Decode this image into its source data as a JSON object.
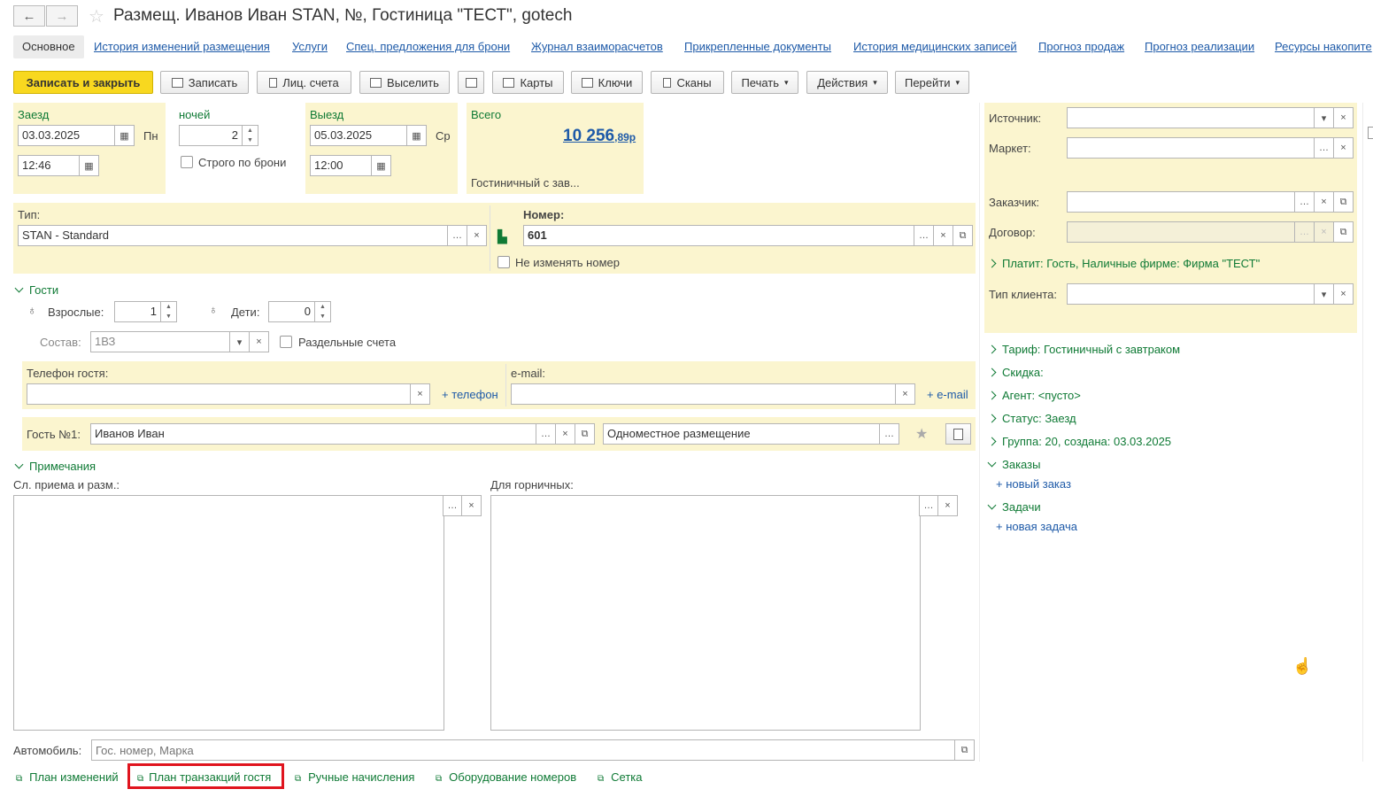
{
  "window": {
    "title": "Размещ. Иванов Иван STAN, №, Гостиница \"ТЕСТ\", gotech"
  },
  "nav": {
    "back": "←",
    "forward": "→"
  },
  "tabs": [
    {
      "label": "Основное"
    },
    {
      "label": "История изменений размещения"
    },
    {
      "label": "Услуги"
    },
    {
      "label": "Спец. предложения для брони"
    },
    {
      "label": "Журнал взаиморасчетов"
    },
    {
      "label": "Прикрепленные документы"
    },
    {
      "label": "История медицинских записей"
    },
    {
      "label": "Прогноз продаж"
    },
    {
      "label": "Прогноз реализации"
    },
    {
      "label": "Ресурсы накопите"
    }
  ],
  "toolbar": {
    "save_close": "Записать и закрыть",
    "save": "Записать",
    "accounts": "Лиц. счета",
    "checkout": "Выселить",
    "cards": "Карты",
    "keys": "Ключи",
    "scans": "Сканы",
    "print": "Печать",
    "actions": "Действия",
    "goto": "Перейти"
  },
  "checkin": {
    "label": "Заезд",
    "date": "03.03.2025",
    "weekday": "Пн",
    "time": "12:46"
  },
  "nights": {
    "label": "ночей",
    "value": "2",
    "strict_label": "Строго по брони"
  },
  "checkout": {
    "label": "Выезд",
    "date": "05.03.2025",
    "weekday": "Ср",
    "time": "12:00"
  },
  "total": {
    "label": "Всего",
    "amount": "10 256",
    "kopecks": ",89р",
    "tariff": "Гостиничный с зав..."
  },
  "room_type": {
    "label": "Тип:",
    "value": "STAN - Standard"
  },
  "room": {
    "label": "Номер:",
    "value": "601",
    "keep_label": "Не изменять номер"
  },
  "guests": {
    "label": "Гости",
    "adults_label": "Взрослые:",
    "adults": "1",
    "children_label": "Дети:",
    "children": "0",
    "composition_label": "Состав:",
    "composition": "1ВЗ",
    "separate_label": "Раздельные счета"
  },
  "contacts": {
    "phone_label": "Телефон гостя:",
    "add_phone": "+ телефон",
    "email_label": "e-mail:",
    "add_email": "+ e-mail"
  },
  "guest1": {
    "label": "Гость №1:",
    "name": "Иванов Иван",
    "accommodation": "Одноместное размещение"
  },
  "notes": {
    "label": "Примечания",
    "reception_label": "Сл. приема и разм.:",
    "housekeeping_label": "Для горничных:"
  },
  "car": {
    "label": "Автомобиль:",
    "placeholder": "Гос. номер, Марка"
  },
  "bottom_links": [
    {
      "label": "План изменений"
    },
    {
      "label": "План транзакций гостя"
    },
    {
      "label": "Ручные начисления"
    },
    {
      "label": "Оборудование номеров"
    },
    {
      "label": "Сетка"
    }
  ],
  "right": {
    "source_label": "Источник:",
    "market_label": "Маркет:",
    "customer_label": "Заказчик:",
    "contract_label": "Договор:",
    "payer": "Платит: Гость, Наличные фирме: Фирма \"ТЕСТ\"",
    "client_type_label": "Тип клиента:",
    "tariff": "Тариф: Гостиничный с завтраком",
    "discount": "Скидка:",
    "agent": "Агент: <пусто>",
    "status": "Статус: Заезд",
    "group": "Группа: 20, создана: 03.03.2025",
    "orders": "Заказы",
    "new_order": "+ новый заказ",
    "tasks": "Задачи",
    "new_task": "+ новая задача"
  },
  "colors": {
    "accent_green": "#0f7a35",
    "link_blue": "#1e5aa8",
    "panel_yellow": "#fbf5cf",
    "primary_button": "#f8d81f",
    "highlight_red": "#e0141e"
  }
}
